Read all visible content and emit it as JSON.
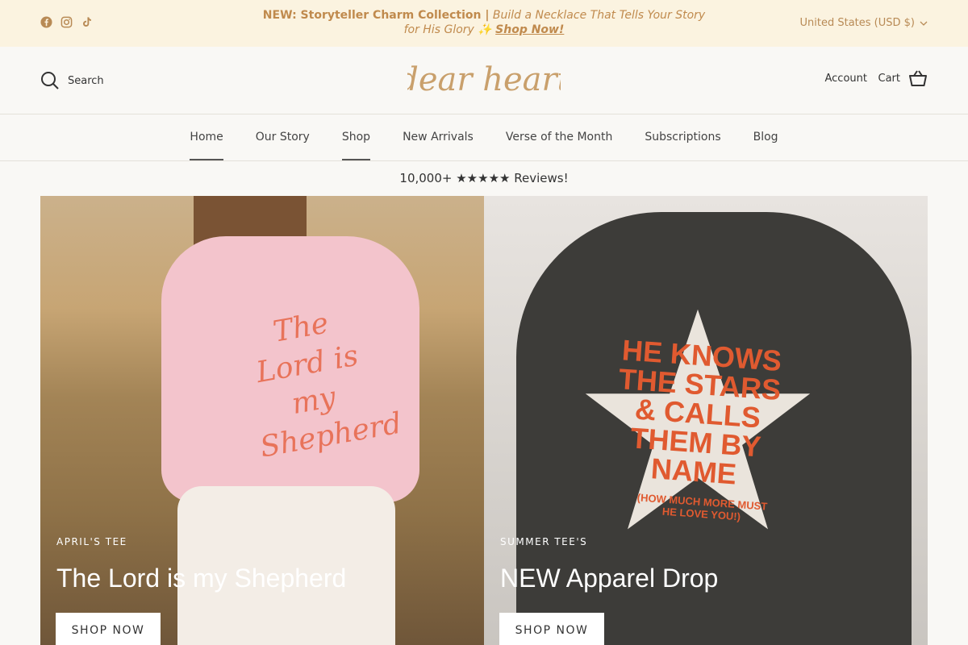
{
  "announcement": {
    "social": [
      {
        "name": "facebook-icon"
      },
      {
        "name": "instagram-icon"
      },
      {
        "name": "tiktok-icon"
      }
    ],
    "bold": "NEW: Storyteller Charm Collection |",
    "italic": "Build a Necklace That Tells Your Story for His Glory ✨",
    "link": "Shop Now!",
    "currency": "United States (USD $)"
  },
  "header": {
    "search_label": "Search",
    "logo": "dear heart",
    "account": "Account",
    "cart": "Cart"
  },
  "nav": [
    "Home",
    "Our Story",
    "Shop",
    "New Arrivals",
    "Verse of the Month",
    "Subscriptions",
    "Blog"
  ],
  "reviews": "10,000+ ★★★★★ Reviews!",
  "hero": {
    "left": {
      "eyebrow": "APRIL'S TEE",
      "headline": "The Lord is my Shepherd",
      "button": "SHOP NOW",
      "shirt_text": "The Lord is my Shepherd"
    },
    "right": {
      "eyebrow": "SUMMER TEE'S",
      "headline": "NEW Apparel Drop",
      "button": "SHOP NOW",
      "shirt_text": "HE KNOWS THE STARS & CALLS THEM BY NAME",
      "shirt_subtext": "(HOW MUCH MORE MUST HE LOVE YOU!)"
    }
  },
  "colors": {
    "accent": "#c08a4d",
    "announce_bg": "#fbf3e0",
    "page_bg": "#f9f8f5"
  }
}
